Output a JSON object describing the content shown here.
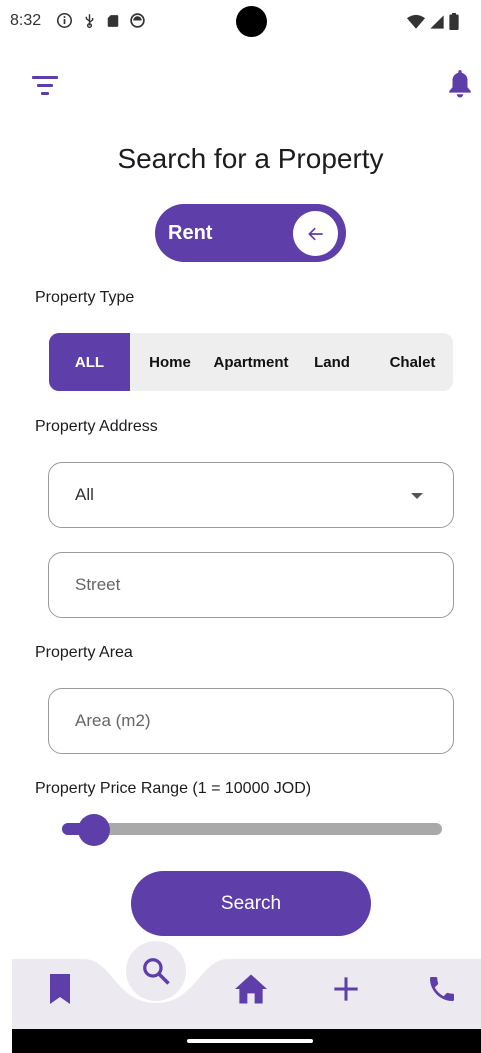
{
  "status_bar": {
    "time": "8:32",
    "left_icons": [
      "info-icon",
      "usb-icon",
      "sd-card-icon",
      "sync-icon"
    ],
    "right_icons": [
      "wifi-icon",
      "signal-icon",
      "battery-icon"
    ]
  },
  "app_bar": {
    "left_icon": "filter-icon",
    "right_icon": "bell-icon"
  },
  "page": {
    "title": "Search for a Property"
  },
  "toggle": {
    "label": "Rent",
    "knob_icon": "arrow-left-icon"
  },
  "property_type": {
    "label": "Property Type",
    "options": [
      "ALL",
      "Home",
      "Apartment",
      "Land",
      "Chalet"
    ],
    "selected": "ALL"
  },
  "property_address": {
    "label": "Property Address",
    "dropdown_value": "All",
    "street_placeholder": "Street"
  },
  "property_area": {
    "label": "Property Area",
    "area_placeholder": "Area (m2)"
  },
  "price_range": {
    "label": "Property Price Range (1 = 10000 JOD)",
    "slider_value_fraction": 0.04
  },
  "search_button": {
    "label": "Search"
  },
  "bottom_nav": {
    "items": [
      "bookmark-icon",
      "search-icon",
      "home-icon",
      "add-icon",
      "phone-icon"
    ],
    "active": "search-icon"
  },
  "colors": {
    "accent": "#5e3ea8",
    "nav_background": "#eceaf0",
    "segment_background": "#eeeeee",
    "slider_track": "#a9a9a9"
  }
}
